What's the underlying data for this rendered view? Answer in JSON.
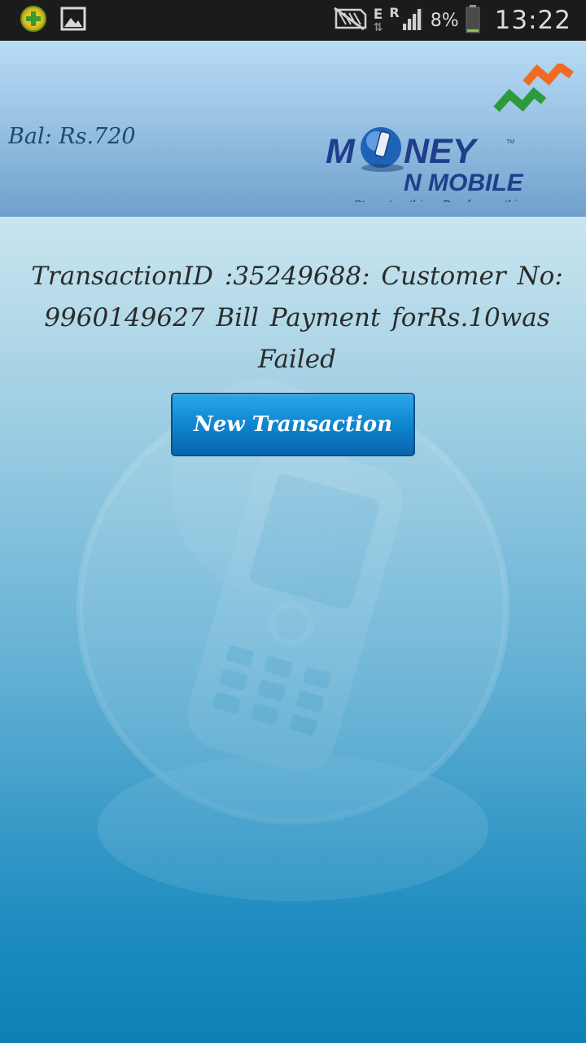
{
  "status_bar": {
    "left_icons": [
      "app-plus-icon",
      "gallery-image-icon"
    ],
    "right_icons": [
      "no-sim-icon",
      "data-e-icon",
      "roaming-signal-icon",
      "battery-icon"
    ],
    "network_type": "E",
    "roaming": "R",
    "battery_percent": "8%",
    "time": "13:22"
  },
  "header": {
    "balance": "Bal: Rs.720",
    "logo": {
      "line1": "MONEY",
      "line2": "N MOBILE",
      "tagline": "Stop at nothing. Pay for anything."
    }
  },
  "main": {
    "message": "TransactionID :35249688:  Customer No: 9960149627  Bill Payment  forRs.10was Failed",
    "new_transaction_label": "New Transaction"
  },
  "colors": {
    "status_bar_bg": "#1b1b1b",
    "button_blue": "#0f86d0",
    "logo_navy": "#1f3e8c",
    "logo_orange": "#f26a21",
    "logo_green": "#2e9a3e"
  }
}
